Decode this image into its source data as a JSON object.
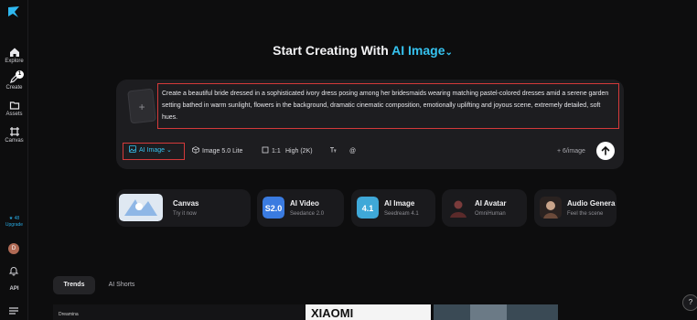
{
  "sidebar": {
    "items": [
      {
        "label": "Explore"
      },
      {
        "label": "Create",
        "badge": "1"
      },
      {
        "label": "Assets"
      },
      {
        "label": "Canvas"
      }
    ],
    "credits": {
      "amount": "★ 48",
      "upgrade": "Upgrade"
    },
    "avatar_initial": "D",
    "api_label": "API"
  },
  "header": {
    "title_prefix": "Start Creating With ",
    "title_accent": "AI Image",
    "chevron": "⌄"
  },
  "prompt": {
    "add_icon": "+",
    "text": "Create a beautiful bride dressed in a sophisticated ivory dress posing among her bridesmaids wearing matching pastel-colored dresses amid a serene garden setting bathed in warm sunlight, flowers in the background, dramatic cinematic composition, emotionally uplifting and joyous scene, extremely detailed, soft hues."
  },
  "toolbar": {
    "model": "AI Image",
    "model_version": "Image 5.0 Lite",
    "ratio": "1:1",
    "quality": "High (2K)",
    "cost": "+ 6/image"
  },
  "tiles": [
    {
      "title": "Canvas",
      "subtitle": "Try it now"
    },
    {
      "title": "AI Video",
      "subtitle": "Seedance 2.0"
    },
    {
      "title": "AI Image",
      "subtitle": "Seedream 4.1"
    },
    {
      "title": "AI Avatar",
      "subtitle": "OmniHuman"
    },
    {
      "title": "Audio Genera",
      "subtitle": "Feel the scene"
    }
  ],
  "tabs": {
    "trends": "Trends",
    "shorts": "AI Shorts"
  },
  "gallery": {
    "card1_brand": "Dreamina",
    "card2_text": "XIAOMI"
  },
  "colors": {
    "accent": "#36c3f0",
    "highlight": "#d43a3a",
    "card_bg": "#1d1d20"
  }
}
